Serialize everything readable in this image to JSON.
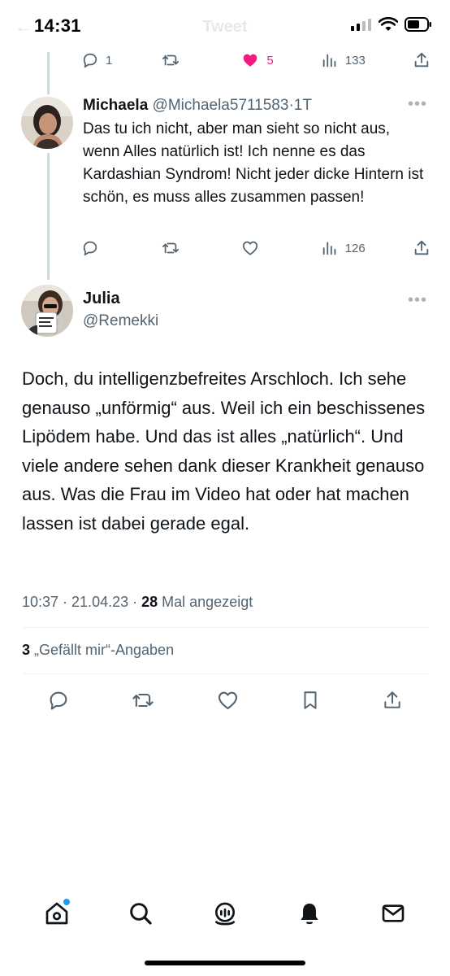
{
  "status_bar": {
    "time": "14:31"
  },
  "header": {
    "title": "Tweet"
  },
  "prev_reply_actions": {
    "replies": "1",
    "retweets": "",
    "likes": "5",
    "views": "133"
  },
  "reply_michaela": {
    "name": "Michaela",
    "handle": "@Michaela5711583",
    "separator": "·",
    "time": "1T",
    "text": "Das tu ich nicht, aber man sieht so nicht aus, wenn Alles natürlich ist! Ich nenne es das Kardashian Syndrom! Nicht jeder dicke Hintern ist schön, es muss alles zusammen passen!",
    "actions": {
      "replies": "",
      "retweets": "",
      "likes": "",
      "views": "126"
    }
  },
  "main_tweet": {
    "name": "Julia",
    "handle": "@Remekki",
    "text": "Doch, du intelligenzbefreites Arschloch. Ich sehe genauso „unförmig“ aus. Weil ich ein beschissenes Lipödem habe. Und das ist alles „natürlich“. Und viele andere sehen dank dieser Krankheit genauso aus. Was die Frau im Video hat oder hat machen lassen ist dabei gerade egal.",
    "time": "10:37 · 21.04.23 · ",
    "views_count": "28",
    "views_label": " Mal angezeigt",
    "likes_count": "3",
    "likes_label": " „Gefällt mir“-Angaben"
  },
  "icons": {
    "reply": "reply-icon",
    "retweet": "retweet-icon",
    "like": "heart-icon",
    "views": "views-icon",
    "share": "share-icon",
    "bookmark": "bookmark-icon",
    "more": "more-icon"
  },
  "bottom_nav": [
    "home-icon",
    "search-icon",
    "spaces-icon",
    "notifications-icon",
    "messages-icon"
  ],
  "colors": {
    "like": "#f91880",
    "accent": "#1d9bf0",
    "secondary_text": "#536471"
  }
}
